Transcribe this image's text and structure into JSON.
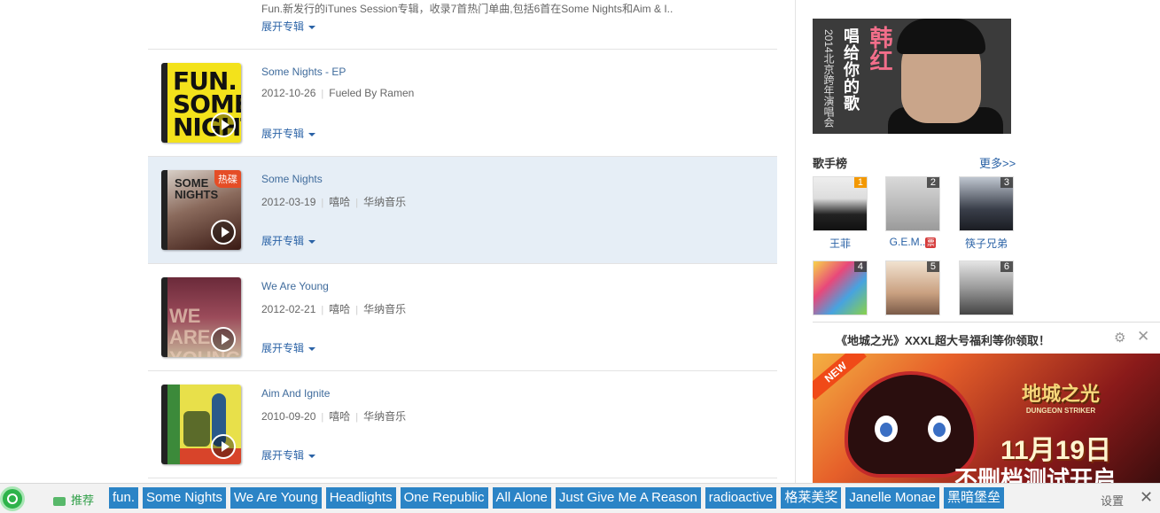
{
  "albums": [
    {
      "description": "Fun.新发行的iTunes Session专辑，收录7首热门单曲,包括6首在Some Nights和Aim & I..",
      "expand": "展开专辑"
    },
    {
      "title": "Some Nights - EP",
      "date": "2012-10-26",
      "label": "Fueled By Ramen",
      "expand": "展开专辑",
      "cover_text": "FUN. SOME NIGHTS"
    },
    {
      "title": "Some Nights",
      "date": "2012-03-19",
      "genre": "嘻哈",
      "label": "华纳音乐",
      "expand": "展开专辑",
      "badge": "热碟",
      "cover_text": "SOME NIGHTS"
    },
    {
      "title": "We Are Young",
      "date": "2012-02-21",
      "genre": "嘻哈",
      "label": "华纳音乐",
      "expand": "展开专辑",
      "cover_text": "WE ARE YOUNG"
    },
    {
      "title": "Aim And Ignite",
      "date": "2010-09-20",
      "genre": "嘻哈",
      "label": "华纳音乐",
      "expand": "展开专辑"
    }
  ],
  "banner": {
    "artist": "韩红",
    "slogan": "唱给你的歌",
    "event": "2014北京跨年演唱会"
  },
  "singer_ranking": {
    "title": "歌手榜",
    "more": "更多>>",
    "singers": [
      {
        "rank": "1",
        "name": "王菲"
      },
      {
        "rank": "2",
        "name": "G.E.M..",
        "ticket": "票"
      },
      {
        "rank": "3",
        "name": "筷子兄弟"
      },
      {
        "rank": "4",
        "name": ""
      },
      {
        "rank": "5",
        "name": ""
      },
      {
        "rank": "6",
        "name": ""
      }
    ]
  },
  "ad": {
    "title": "《地城之光》XXXL超大号福利等你领取！",
    "badge": "NEW",
    "logo": "地城之光",
    "logo_sub": "DUNGEON STRIKER",
    "date": "11月19日",
    "subtitle": "不删档测试开启"
  },
  "bottom_bar": {
    "recommend": "推荐",
    "tags": [
      "fun.",
      "Some Nights",
      "We Are Young",
      "Headlights",
      "One Republic",
      "All Alone",
      "Just Give Me A Reason",
      "radioactive",
      "格莱美奖",
      "Janelle Monae",
      "黑暗堡垒"
    ],
    "settings": "设置",
    "close": "✕"
  },
  "icons": {
    "settings": "gear-icon",
    "close": "close-icon"
  },
  "colors": {
    "link": "#2a62a6",
    "tag_bg": "#2b84c6",
    "highlight_row": "#e6eef6",
    "hot_badge": "#e54d26"
  }
}
